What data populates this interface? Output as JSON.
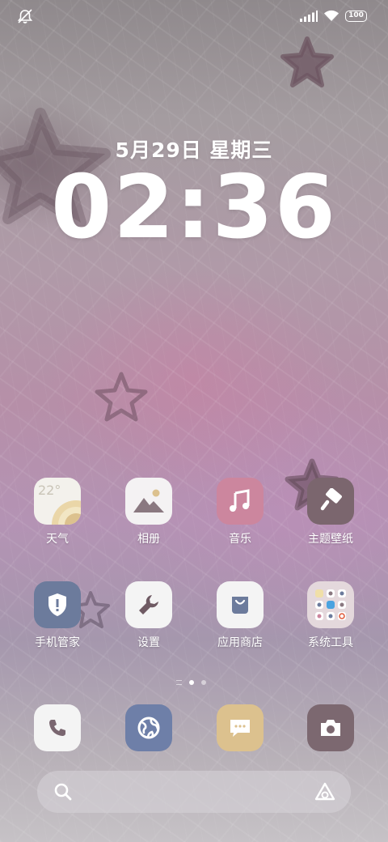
{
  "status_bar": {
    "battery": "100",
    "left_icon": "mute-icon",
    "right_icons": [
      "signal-icon",
      "wifi-icon",
      "battery-icon"
    ]
  },
  "lockclock": {
    "date": "5月29日 星期三",
    "time": "02:36"
  },
  "apps": [
    {
      "label": "天气",
      "icon": "weather-icon",
      "extra": "22°"
    },
    {
      "label": "相册",
      "icon": "gallery-icon"
    },
    {
      "label": "音乐",
      "icon": "music-icon"
    },
    {
      "label": "主题壁纸",
      "icon": "theme-icon"
    },
    {
      "label": "手机管家",
      "icon": "security-shield-icon"
    },
    {
      "label": "设置",
      "icon": "settings-wrench-icon"
    },
    {
      "label": "应用商店",
      "icon": "app-store-bag-icon"
    },
    {
      "label": "系统工具",
      "icon": "folder-icon"
    }
  ],
  "dock": [
    {
      "icon": "phone-icon"
    },
    {
      "icon": "browser-icon"
    },
    {
      "icon": "messages-icon"
    },
    {
      "icon": "camera-icon"
    }
  ],
  "colors": {
    "music": "#cc869e",
    "theme": "#7b666e",
    "security": "#6c7b9c",
    "browser": "#6e7fa8",
    "messages": "#dcc18e",
    "camera": "#7c6870"
  }
}
